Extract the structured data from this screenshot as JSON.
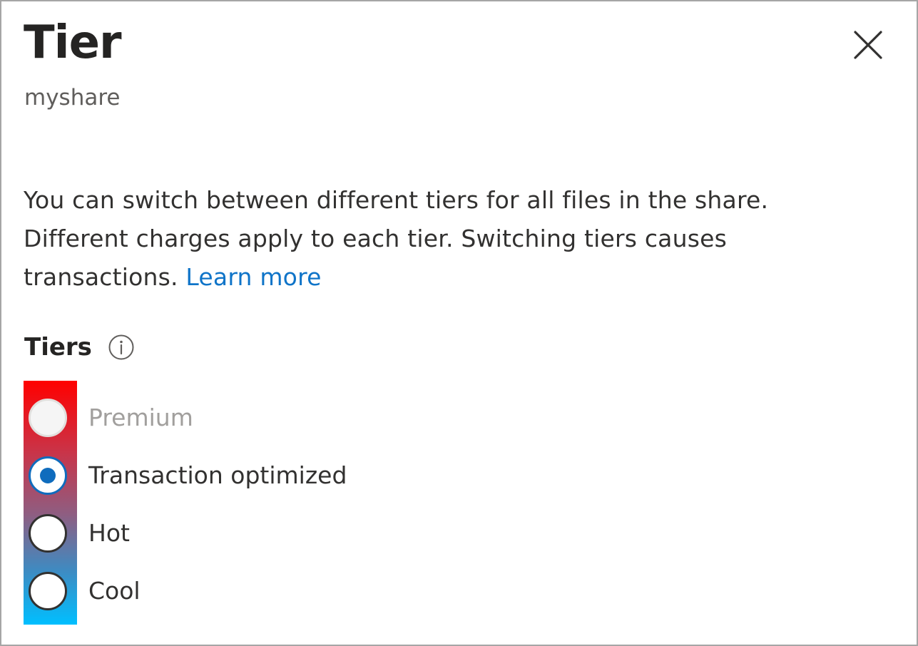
{
  "panel": {
    "title": "Tier",
    "subtitle": "myshare",
    "close_icon": "close-icon"
  },
  "description": {
    "text": "You can switch between different tiers for all files in the share. Different charges apply to each tier. Switching tiers causes transactions.",
    "link_label": "Learn more",
    "link_color": "#0f74c8"
  },
  "tiers": {
    "label": "Tiers",
    "info_icon": "info-icon",
    "selected": "Transaction optimized",
    "options": [
      {
        "label": "Premium",
        "checked": false,
        "disabled": true
      },
      {
        "label": "Transaction optimized",
        "checked": true,
        "disabled": false
      },
      {
        "label": "Hot",
        "checked": false,
        "disabled": false
      },
      {
        "label": "Cool",
        "checked": false,
        "disabled": false
      }
    ],
    "accent_color": "#0f6cbd",
    "highlight_gradient": [
      "#ff0000",
      "#00bfff"
    ]
  }
}
